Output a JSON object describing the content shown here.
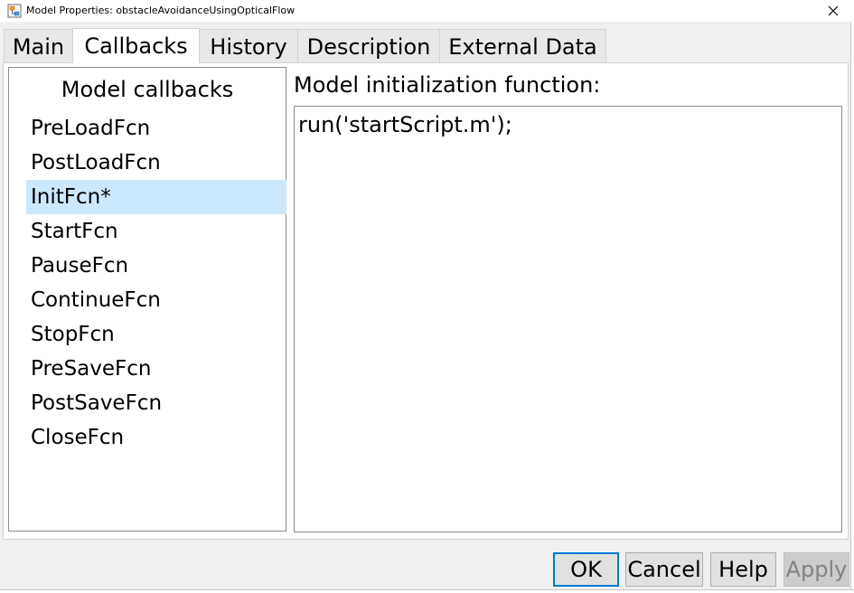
{
  "window": {
    "title": "Model Properties: obstacleAvoidanceUsingOpticalFlow",
    "app_icon": "simulink-model-icon",
    "close_icon": "close-icon"
  },
  "tabs": [
    {
      "label": "Main",
      "active": false
    },
    {
      "label": "Callbacks",
      "active": true
    },
    {
      "label": "History",
      "active": false
    },
    {
      "label": "Description",
      "active": false
    },
    {
      "label": "External Data",
      "active": false
    }
  ],
  "callbacks_panel": {
    "header": "Model callbacks",
    "items": [
      {
        "label": "PreLoadFcn",
        "selected": false
      },
      {
        "label": "PostLoadFcn",
        "selected": false
      },
      {
        "label": "InitFcn*",
        "selected": true
      },
      {
        "label": "StartFcn",
        "selected": false
      },
      {
        "label": "PauseFcn",
        "selected": false
      },
      {
        "label": "ContinueFcn",
        "selected": false
      },
      {
        "label": "StopFcn",
        "selected": false
      },
      {
        "label": "PreSaveFcn",
        "selected": false
      },
      {
        "label": "PostSaveFcn",
        "selected": false
      },
      {
        "label": "CloseFcn",
        "selected": false
      }
    ]
  },
  "editor": {
    "label": "Model initialization function:",
    "value": "run('startScript.m');"
  },
  "buttons": {
    "ok": "OK",
    "cancel": "Cancel",
    "help": "Help",
    "apply": "Apply"
  },
  "colors": {
    "selection": "#cce8ff",
    "default_button_border": "#0078d7"
  }
}
